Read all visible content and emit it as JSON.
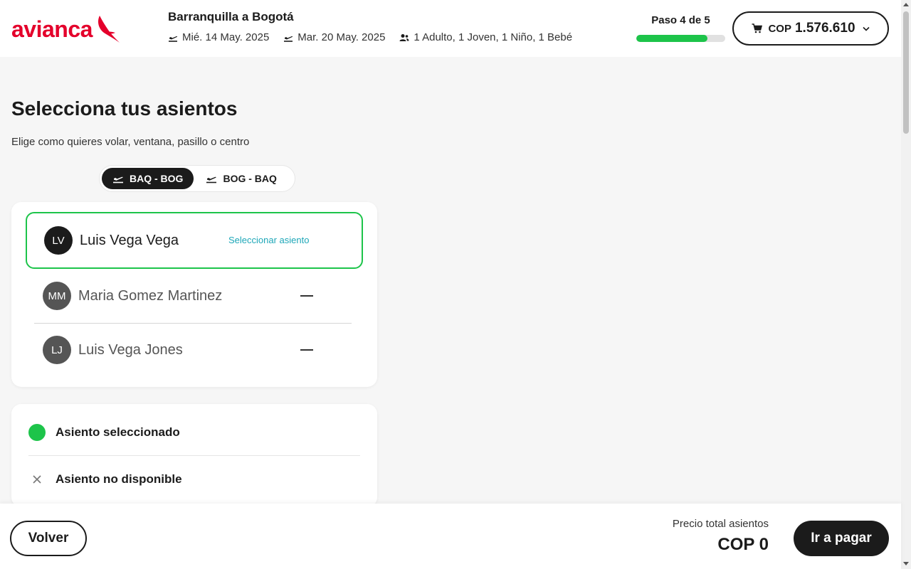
{
  "header": {
    "logo_text": "avianca",
    "trip_title": "Barranquilla a Bogotá",
    "departure_date": "Mié. 14 May. 2025",
    "return_date": "Mar. 20 May. 2025",
    "passengers_summary": "1 Adulto, 1 Joven, 1 Niño, 1 Bebé",
    "step_label": "Paso 4 de 5",
    "step_progress_fraction": 0.8,
    "cart_currency": "COP",
    "cart_amount": "1.576.610"
  },
  "main": {
    "title": "Selecciona tus asientos",
    "subtitle": "Elige como quieres volar, ventana, pasillo o centro",
    "route_tabs": [
      {
        "label": "BAQ - BOG",
        "active": true
      },
      {
        "label": "BOG - BAQ",
        "active": false
      }
    ],
    "passengers": [
      {
        "initials": "LV",
        "name": "Luis Vega Vega",
        "action": "Seleccionar asiento",
        "selected": true
      },
      {
        "initials": "MM",
        "name": "Maria Gomez Martinez",
        "selected": false
      },
      {
        "initials": "LJ",
        "name": "Luis Vega Jones",
        "selected": false
      }
    ],
    "legend": [
      {
        "label": "Asiento seleccionado",
        "icon": "green-dot-icon"
      },
      {
        "label": "Asiento no disponible",
        "icon": "close-icon"
      }
    ]
  },
  "footer": {
    "back_label": "Volver",
    "total_label": "Precio total asientos",
    "total_value": "COP 0",
    "pay_label": "Ir a pagar"
  },
  "colors": {
    "brand_red": "#e4002b",
    "accent_green": "#1dc44a",
    "link_teal": "#1ea7b8",
    "dark": "#1b1b1b"
  }
}
